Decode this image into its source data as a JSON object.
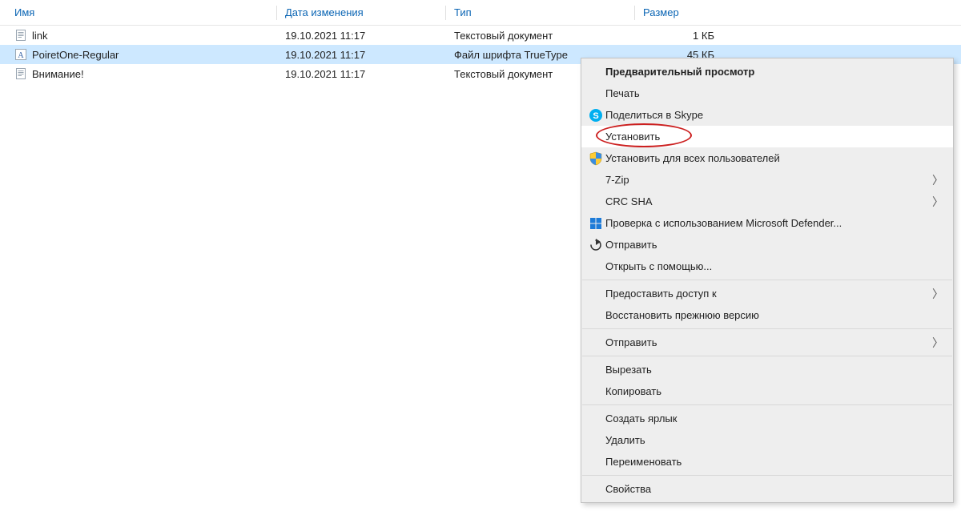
{
  "columns": {
    "name": "Имя",
    "date": "Дата изменения",
    "type": "Тип",
    "size": "Размер"
  },
  "files": [
    {
      "name": "link",
      "date": "19.10.2021 11:17",
      "type": "Текстовый документ",
      "size": "1 КБ",
      "icon": "txt",
      "selected": false
    },
    {
      "name": "PoiretOne-Regular",
      "date": "19.10.2021 11:17",
      "type": "Файл шрифта TrueType",
      "size": "45 КБ",
      "icon": "font",
      "selected": true
    },
    {
      "name": "Внимание!",
      "date": "19.10.2021 11:17",
      "type": "Текстовый документ",
      "size": "",
      "icon": "txt",
      "selected": false
    }
  ],
  "context_menu": {
    "groups": [
      [
        {
          "label": "Предварительный просмотр",
          "bold": true,
          "icon": null,
          "submenu": false,
          "highlighted": false
        },
        {
          "label": "Печать",
          "bold": false,
          "icon": null,
          "submenu": false,
          "highlighted": false
        },
        {
          "label": "Поделиться в Skype",
          "bold": false,
          "icon": "skype",
          "submenu": false,
          "highlighted": false
        },
        {
          "label": "Установить",
          "bold": false,
          "icon": null,
          "submenu": false,
          "highlighted": true,
          "annotated": true
        },
        {
          "label": "Установить для всех пользователей",
          "bold": false,
          "icon": "shield",
          "submenu": false,
          "highlighted": false
        },
        {
          "label": "7-Zip",
          "bold": false,
          "icon": null,
          "submenu": true,
          "highlighted": false
        },
        {
          "label": "CRC SHA",
          "bold": false,
          "icon": null,
          "submenu": true,
          "highlighted": false
        },
        {
          "label": "Проверка с использованием Microsoft Defender...",
          "bold": false,
          "icon": "defender",
          "submenu": false,
          "highlighted": false
        },
        {
          "label": "Отправить",
          "bold": false,
          "icon": "share",
          "submenu": false,
          "highlighted": false
        },
        {
          "label": "Открыть с помощью...",
          "bold": false,
          "icon": null,
          "submenu": false,
          "highlighted": false
        }
      ],
      [
        {
          "label": "Предоставить доступ к",
          "bold": false,
          "icon": null,
          "submenu": true,
          "highlighted": false
        },
        {
          "label": "Восстановить прежнюю версию",
          "bold": false,
          "icon": null,
          "submenu": false,
          "highlighted": false
        }
      ],
      [
        {
          "label": "Отправить",
          "bold": false,
          "icon": null,
          "submenu": true,
          "highlighted": false
        }
      ],
      [
        {
          "label": "Вырезать",
          "bold": false,
          "icon": null,
          "submenu": false,
          "highlighted": false
        },
        {
          "label": "Копировать",
          "bold": false,
          "icon": null,
          "submenu": false,
          "highlighted": false
        }
      ],
      [
        {
          "label": "Создать ярлык",
          "bold": false,
          "icon": null,
          "submenu": false,
          "highlighted": false
        },
        {
          "label": "Удалить",
          "bold": false,
          "icon": null,
          "submenu": false,
          "highlighted": false
        },
        {
          "label": "Переименовать",
          "bold": false,
          "icon": null,
          "submenu": false,
          "highlighted": false
        }
      ],
      [
        {
          "label": "Свойства",
          "bold": false,
          "icon": null,
          "submenu": false,
          "highlighted": false
        }
      ]
    ]
  }
}
